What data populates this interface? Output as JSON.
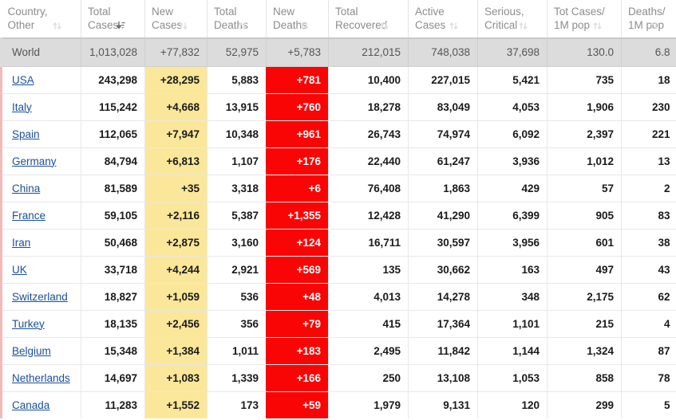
{
  "table": {
    "columns": [
      {
        "line1": "Country,",
        "line2": "Other",
        "sort": "inactive",
        "key": "country"
      },
      {
        "line1": "Total",
        "line2": "Cases",
        "sort": "desc",
        "key": "total_cases"
      },
      {
        "line1": "New",
        "line2": "Cases",
        "sort": "inactive",
        "key": "new_cases"
      },
      {
        "line1": "Total",
        "line2": "Deaths",
        "sort": "inactive",
        "key": "total_deaths"
      },
      {
        "line1": "New",
        "line2": "Deaths",
        "sort": "inactive",
        "key": "new_deaths"
      },
      {
        "line1": "Total",
        "line2": "Recovered",
        "sort": "inactive",
        "key": "total_recovered"
      },
      {
        "line1": "Active",
        "line2": "Cases",
        "sort": "inactive",
        "key": "active_cases"
      },
      {
        "line1": "Serious,",
        "line2": "Critical",
        "sort": "inactive",
        "key": "serious_critical"
      },
      {
        "line1": "Tot Cases/",
        "line2": "1M pop",
        "sort": "inactive",
        "key": "tot_cases_per_1m"
      },
      {
        "line1": "Deaths/",
        "line2": "1M pop",
        "sort": "inactive",
        "key": "deaths_per_1m"
      }
    ],
    "world_row": {
      "country": "World",
      "total_cases": "1,013,028",
      "new_cases": "+77,832",
      "total_deaths": "52,975",
      "new_deaths": "+5,783",
      "total_recovered": "212,015",
      "active_cases": "748,038",
      "serious_critical": "37,698",
      "tot_cases_per_1m": "130.0",
      "deaths_per_1m": "6.8"
    },
    "rows": [
      {
        "country": "USA",
        "total_cases": "243,298",
        "new_cases": "+28,295",
        "total_deaths": "5,883",
        "new_deaths": "+781",
        "total_recovered": "10,400",
        "active_cases": "227,015",
        "serious_critical": "5,421",
        "tot_cases_per_1m": "735",
        "deaths_per_1m": "18"
      },
      {
        "country": "Italy",
        "total_cases": "115,242",
        "new_cases": "+4,668",
        "total_deaths": "13,915",
        "new_deaths": "+760",
        "total_recovered": "18,278",
        "active_cases": "83,049",
        "serious_critical": "4,053",
        "tot_cases_per_1m": "1,906",
        "deaths_per_1m": "230"
      },
      {
        "country": "Spain",
        "total_cases": "112,065",
        "new_cases": "+7,947",
        "total_deaths": "10,348",
        "new_deaths": "+961",
        "total_recovered": "26,743",
        "active_cases": "74,974",
        "serious_critical": "6,092",
        "tot_cases_per_1m": "2,397",
        "deaths_per_1m": "221"
      },
      {
        "country": "Germany",
        "total_cases": "84,794",
        "new_cases": "+6,813",
        "total_deaths": "1,107",
        "new_deaths": "+176",
        "total_recovered": "22,440",
        "active_cases": "61,247",
        "serious_critical": "3,936",
        "tot_cases_per_1m": "1,012",
        "deaths_per_1m": "13"
      },
      {
        "country": "China",
        "total_cases": "81,589",
        "new_cases": "+35",
        "total_deaths": "3,318",
        "new_deaths": "+6",
        "total_recovered": "76,408",
        "active_cases": "1,863",
        "serious_critical": "429",
        "tot_cases_per_1m": "57",
        "deaths_per_1m": "2"
      },
      {
        "country": "France",
        "total_cases": "59,105",
        "new_cases": "+2,116",
        "total_deaths": "5,387",
        "new_deaths": "+1,355",
        "total_recovered": "12,428",
        "active_cases": "41,290",
        "serious_critical": "6,399",
        "tot_cases_per_1m": "905",
        "deaths_per_1m": "83"
      },
      {
        "country": "Iran",
        "total_cases": "50,468",
        "new_cases": "+2,875",
        "total_deaths": "3,160",
        "new_deaths": "+124",
        "total_recovered": "16,711",
        "active_cases": "30,597",
        "serious_critical": "3,956",
        "tot_cases_per_1m": "601",
        "deaths_per_1m": "38"
      },
      {
        "country": "UK",
        "total_cases": "33,718",
        "new_cases": "+4,244",
        "total_deaths": "2,921",
        "new_deaths": "+569",
        "total_recovered": "135",
        "active_cases": "30,662",
        "serious_critical": "163",
        "tot_cases_per_1m": "497",
        "deaths_per_1m": "43"
      },
      {
        "country": "Switzerland",
        "total_cases": "18,827",
        "new_cases": "+1,059",
        "total_deaths": "536",
        "new_deaths": "+48",
        "total_recovered": "4,013",
        "active_cases": "14,278",
        "serious_critical": "348",
        "tot_cases_per_1m": "2,175",
        "deaths_per_1m": "62"
      },
      {
        "country": "Turkey",
        "total_cases": "18,135",
        "new_cases": "+2,456",
        "total_deaths": "356",
        "new_deaths": "+79",
        "total_recovered": "415",
        "active_cases": "17,364",
        "serious_critical": "1,101",
        "tot_cases_per_1m": "215",
        "deaths_per_1m": "4"
      },
      {
        "country": "Belgium",
        "total_cases": "15,348",
        "new_cases": "+1,384",
        "total_deaths": "1,011",
        "new_deaths": "+183",
        "total_recovered": "2,495",
        "active_cases": "11,842",
        "serious_critical": "1,144",
        "tot_cases_per_1m": "1,324",
        "deaths_per_1m": "87"
      },
      {
        "country": "Netherlands",
        "total_cases": "14,697",
        "new_cases": "+1,083",
        "total_deaths": "1,339",
        "new_deaths": "+166",
        "total_recovered": "250",
        "active_cases": "13,108",
        "serious_critical": "1,053",
        "tot_cases_per_1m": "858",
        "deaths_per_1m": "78"
      },
      {
        "country": "Canada",
        "total_cases": "11,283",
        "new_cases": "+1,552",
        "total_deaths": "173",
        "new_deaths": "+59",
        "total_recovered": "1,979",
        "active_cases": "9,131",
        "serious_critical": "120",
        "tot_cases_per_1m": "299",
        "deaths_per_1m": "5"
      }
    ]
  },
  "colors": {
    "new_cases_bg": "#fbe79a",
    "new_deaths_bg": "#fa0505",
    "world_row_bg": "#dcdcdc",
    "link": "#1a4f9c",
    "header_text": "#8d8d8d",
    "row_left_accent": "#f4b9b9"
  }
}
